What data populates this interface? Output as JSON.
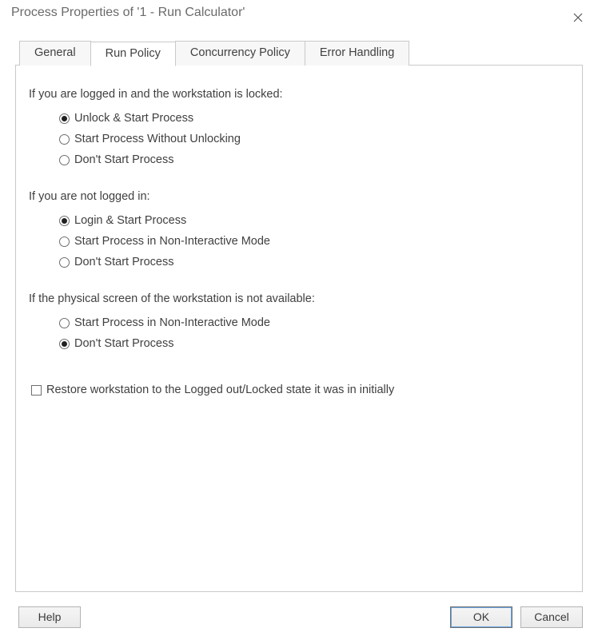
{
  "window": {
    "title": "Process Properties of '1 - Run Calculator'"
  },
  "tabs": {
    "general": "General",
    "run_policy": "Run Policy",
    "concurrency_policy": "Concurrency Policy",
    "error_handling": "Error Handling",
    "active": "run_policy"
  },
  "groups": {
    "locked": {
      "label": "If you are logged in and the workstation is locked:",
      "options": [
        {
          "label": "Unlock & Start Process",
          "selected": true
        },
        {
          "label": "Start Process Without Unlocking",
          "selected": false
        },
        {
          "label": "Don't Start Process",
          "selected": false
        }
      ]
    },
    "not_logged_in": {
      "label": "If you are not logged in:",
      "options": [
        {
          "label": "Login & Start Process",
          "selected": true
        },
        {
          "label": "Start Process in Non-Interactive Mode",
          "selected": false
        },
        {
          "label": "Don't Start Process",
          "selected": false
        }
      ]
    },
    "no_screen": {
      "label": "If the physical screen of the workstation is not available:",
      "options": [
        {
          "label": "Start Process in Non-Interactive Mode",
          "selected": false
        },
        {
          "label": "Don't Start Process",
          "selected": true
        }
      ]
    }
  },
  "restore_checkbox": {
    "label": "Restore workstation to the Logged out/Locked state it was in initially",
    "checked": false
  },
  "buttons": {
    "help": "Help",
    "ok": "OK",
    "cancel": "Cancel"
  }
}
